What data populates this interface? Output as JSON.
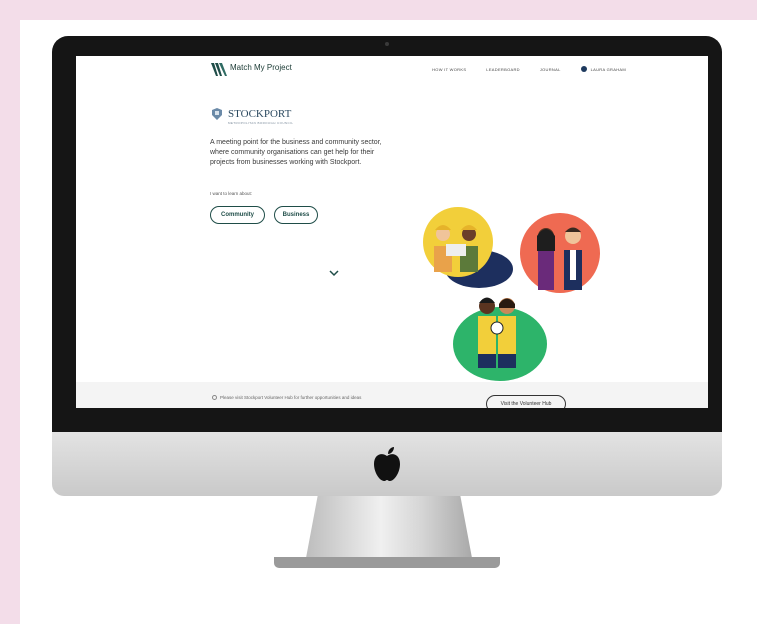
{
  "header": {
    "brand": "Match My Project",
    "nav": [
      "HOW IT WORKS",
      "LEADERBOARD",
      "JOURNAL"
    ],
    "user": "LAURA GRAHAM"
  },
  "council": {
    "name": "STOCKPORT",
    "subtitle": "METROPOLITAN BOROUGH COUNCIL"
  },
  "hero": {
    "intro": "A meeting point for the business and community sector, where community organisations can get help for their projects from businesses working with Stockport.",
    "learn_label": "I want to learn about:",
    "community_label": "Community",
    "business_label": "Business"
  },
  "footer": {
    "notice": "Please visit Stockport Volunteer Hub for further opportunities and ideas",
    "volunteer_label": "Visit the Volunteer Hub"
  },
  "colors": {
    "accent": "#1f4d48",
    "page_pink": "#f3dde9",
    "yellow": "#f2cf3a",
    "coral": "#ef6a52",
    "green": "#2db46a",
    "navy": "#1d2f5e"
  },
  "icons": [
    "logo-icon",
    "user-icon",
    "crest-icon",
    "chevron-down-icon",
    "info-icon",
    "apple-logo-icon"
  ]
}
